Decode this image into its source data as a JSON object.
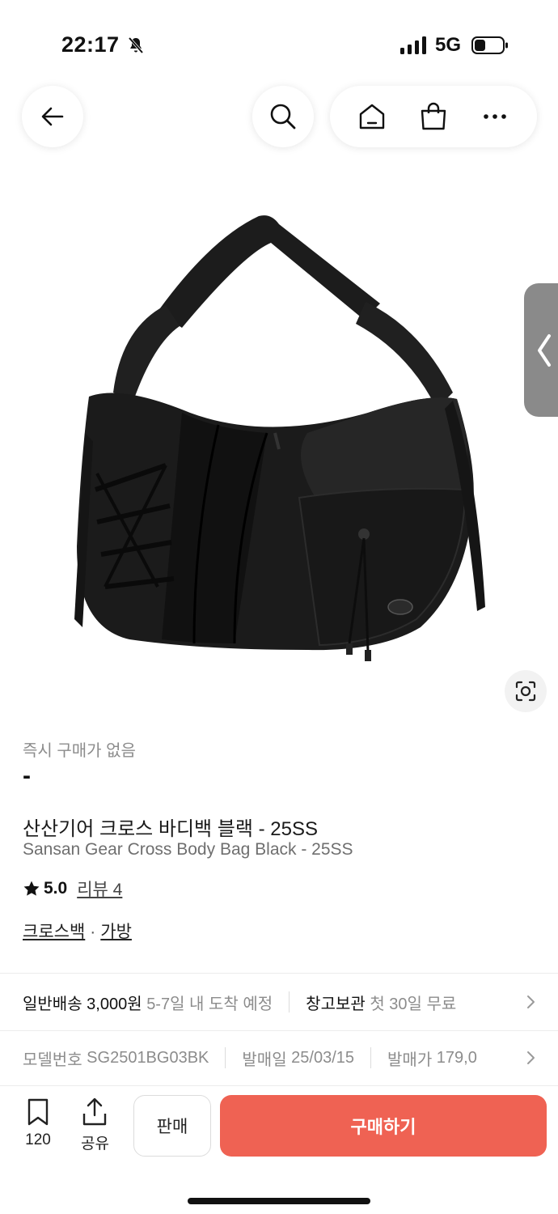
{
  "status_bar": {
    "time": "22:17",
    "network": "5G"
  },
  "nav": {
    "back_icon": "arrow-left-icon",
    "search_icon": "search-icon",
    "home_icon": "home-icon",
    "cart_icon": "shopping-bag-icon",
    "more_icon": "more-horizontal-icon"
  },
  "product": {
    "instant_label": "즉시 구매가 없음",
    "price": "-",
    "title_ko": "산산기어 크로스 바디백 블랙 - 25SS",
    "title_en": "Sansan Gear Cross Body Bag Black - 25SS",
    "rating": "5.0",
    "review_label": "리뷰 4",
    "categories": [
      "크로스백",
      "가방"
    ]
  },
  "shipping": {
    "type": "일반배송",
    "fee": "3,000원",
    "eta": "5-7일 내 도착 예정",
    "storage": "창고보관",
    "storage_offer": "첫 30일 무료"
  },
  "meta": {
    "model_label": "모델번호",
    "model_value": "SG2501BG03BK",
    "release_label": "발매일",
    "release_value": "25/03/15",
    "retail_label": "발매가",
    "retail_value": "179,0"
  },
  "bottom_bar": {
    "wish_count": "120",
    "share_label": "공유",
    "sell_label": "판매",
    "buy_label": "구매하기"
  },
  "colors": {
    "buy_accent": "#ef6253",
    "muted_text": "#8c8c8c"
  }
}
